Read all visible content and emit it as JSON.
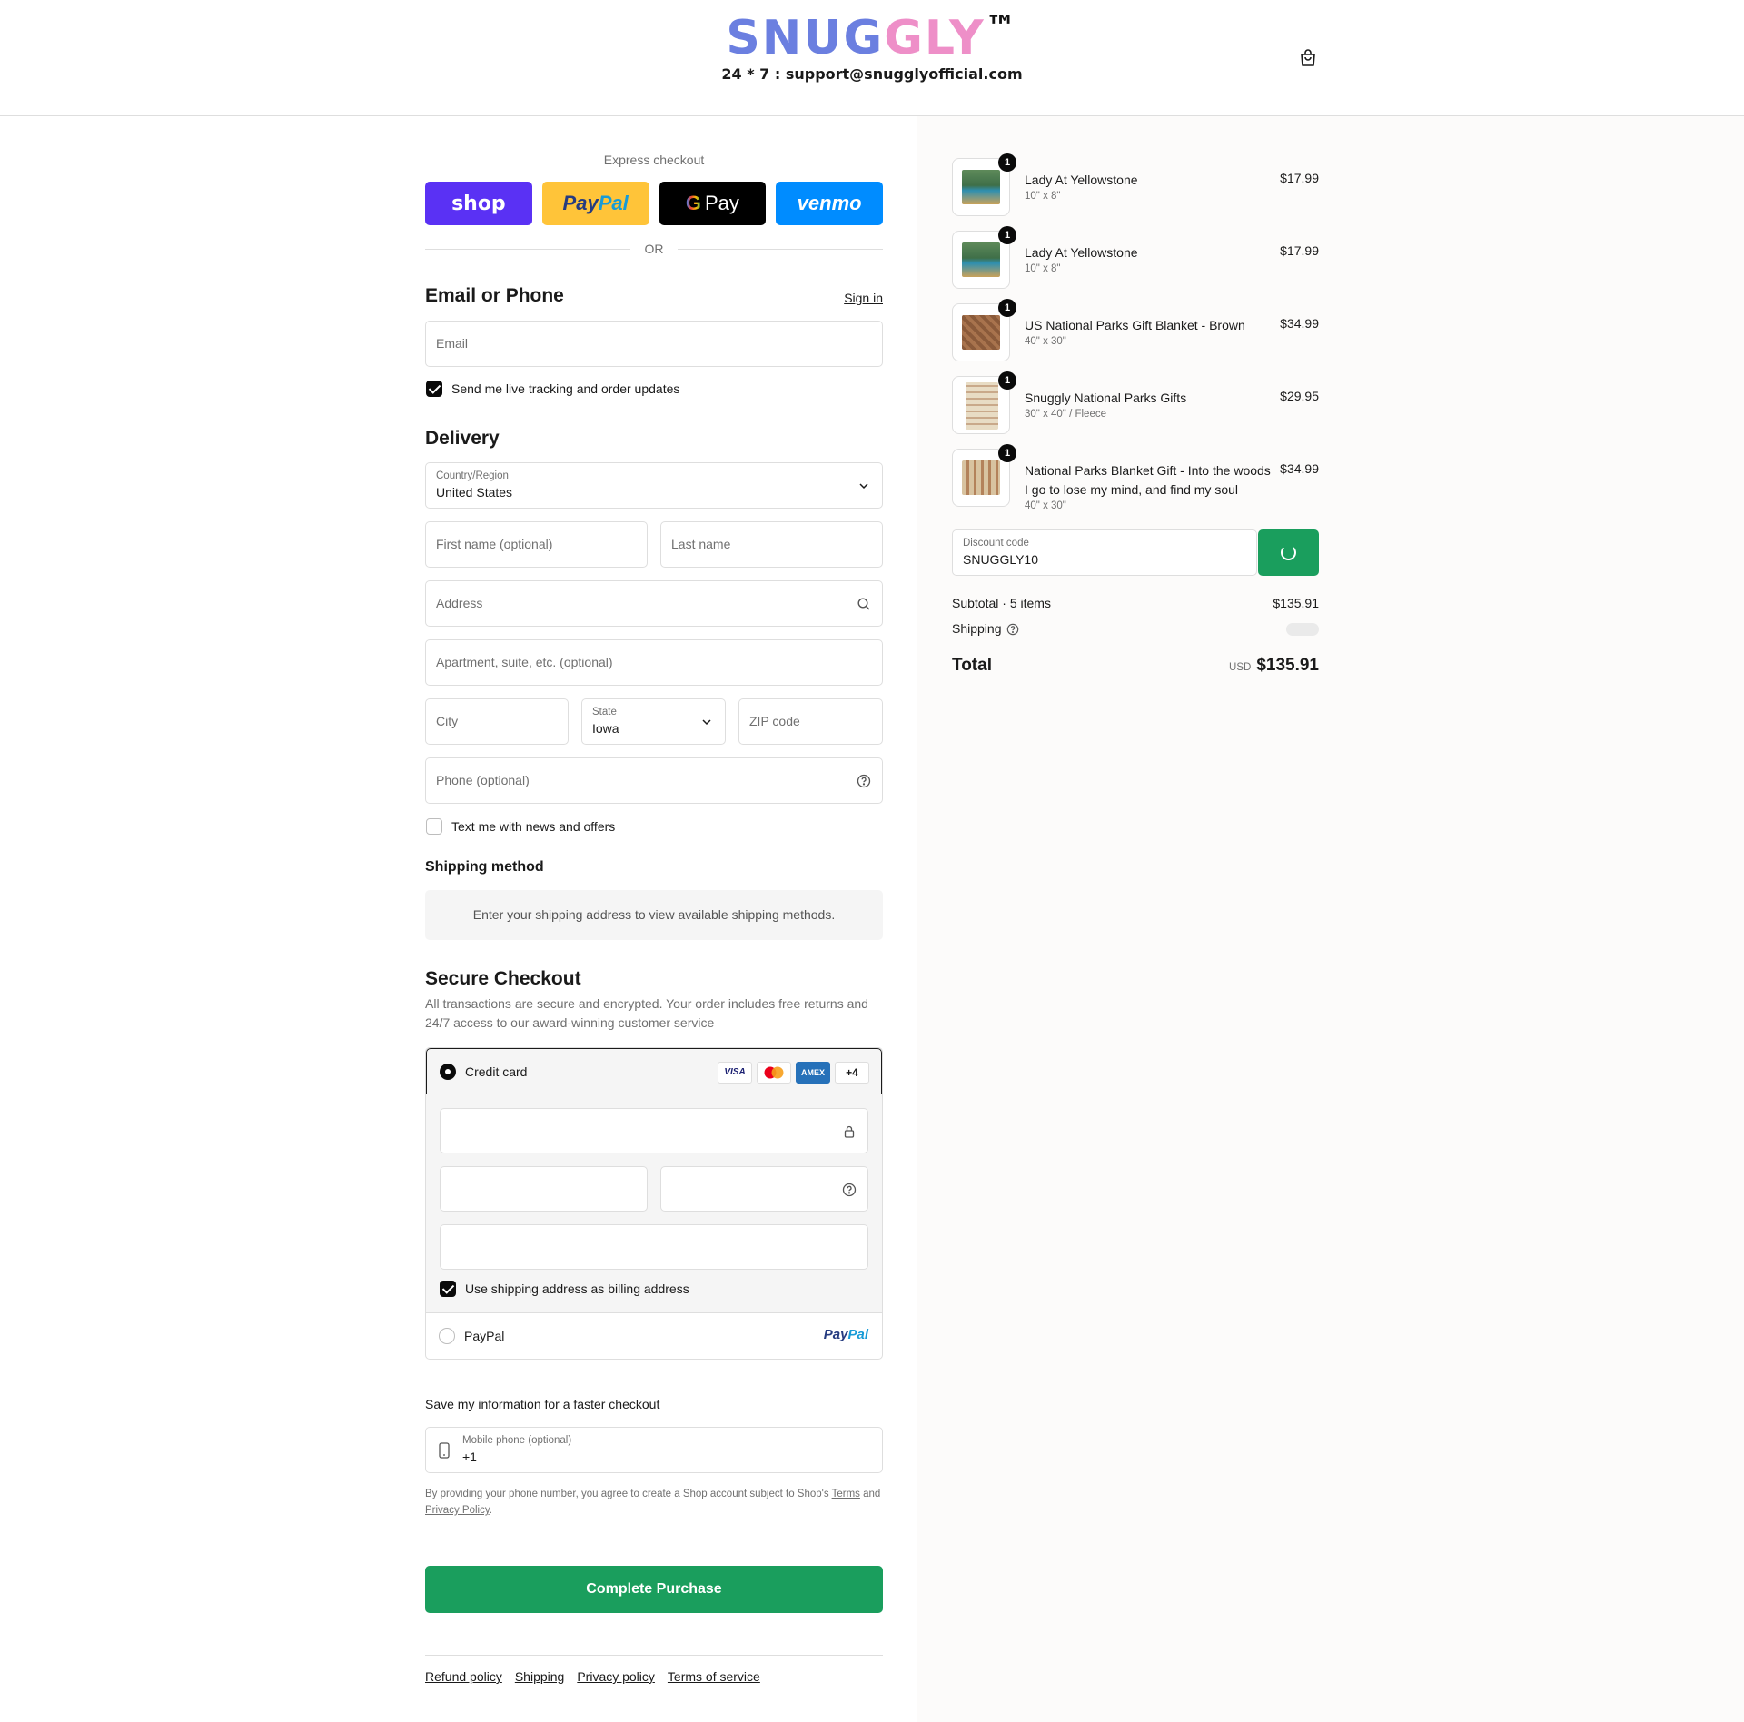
{
  "header": {
    "logo_part1": "SNUG",
    "logo_part2": "GLY",
    "logo_tm": "™",
    "support": "24 * 7 : support@snugglyofficial.com",
    "cart_icon": "shopping-bag-icon"
  },
  "express": {
    "label": "Express checkout",
    "shop": "shop",
    "paypal_1": "Pay",
    "paypal_2": "Pal",
    "gpay_g": "G",
    "gpay": "Pay",
    "venmo": "venmo",
    "or": "OR"
  },
  "contact": {
    "title": "Email or Phone",
    "signin": "Sign in",
    "email_placeholder": "Email",
    "tracking_label": "Send me live tracking and order updates",
    "tracking_checked": true
  },
  "delivery": {
    "title": "Delivery",
    "country_label": "Country/Region",
    "country_value": "United States",
    "first_name_placeholder": "First name (optional)",
    "last_name_placeholder": "Last name",
    "address_placeholder": "Address",
    "apartment_placeholder": "Apartment, suite, etc. (optional)",
    "city_placeholder": "City",
    "state_label": "State",
    "state_value": "Iowa",
    "zip_placeholder": "ZIP code",
    "phone_placeholder": "Phone (optional)",
    "sms_label": "Text me with news and offers",
    "sms_checked": false
  },
  "shipping_method": {
    "title": "Shipping method",
    "note": "Enter your shipping address to view available shipping methods."
  },
  "payment": {
    "title": "Secure Checkout",
    "description": "All transactions are secure and encrypted. Your order includes free returns and 24/7 access to our award-winning customer service",
    "credit_card_label": "Credit card",
    "card_visa": "VISA",
    "card_amex": "AMEX",
    "card_more": "+4",
    "billing_label": "Use shipping address as billing address",
    "billing_checked": true,
    "paypal_label": "PayPal",
    "paypal_logo_1": "Pay",
    "paypal_logo_2": "Pal"
  },
  "save_info": {
    "title": "Save my information for a faster checkout",
    "mobile_label": "Mobile phone (optional)",
    "mobile_value": "+1",
    "terms_1": "By providing your phone number, you agree to create a Shop account subject to Shop's ",
    "terms_link": "Terms",
    "terms_2": " and ",
    "privacy_link": "Privacy Policy",
    "terms_3": "."
  },
  "complete_button": "Complete Purchase",
  "footer_links": [
    "Refund policy",
    "Shipping",
    "Privacy policy",
    "Terms of service"
  ],
  "order_items": [
    {
      "qty": "1",
      "name": "Lady At Yellowstone",
      "variant": "10\" x 8\"",
      "price": "$17.99"
    },
    {
      "qty": "1",
      "name": "Lady At Yellowstone",
      "variant": "10\" x 8\"",
      "price": "$17.99"
    },
    {
      "qty": "1",
      "name": "US National Parks Gift Blanket - Brown",
      "variant": "40\" x 30\"",
      "price": "$34.99"
    },
    {
      "qty": "1",
      "name": "Snuggly National Parks Gifts",
      "variant": "30\" x 40\" / Fleece",
      "price": "$29.95"
    },
    {
      "qty": "1",
      "name": "National Parks Blanket Gift - Into the woods I go to lose my mind, and find my soul",
      "variant": "40\" x 30\"",
      "price": "$34.99"
    }
  ],
  "summary": {
    "discount_label": "Discount code",
    "discount_value": "SNUGGLY10",
    "subtotal_label": "Subtotal · 5 items",
    "subtotal_value": "$135.91",
    "shipping_label": "Shipping",
    "total_label": "Total",
    "currency": "USD",
    "total_value": "$135.91"
  },
  "colors": {
    "accent_green": "#1a9e5d",
    "logo_blue": "#6b7fe0",
    "logo_pink": "#ee8fc8",
    "shop_purple": "#5a31f4",
    "paypal_yellow": "#ffc439",
    "venmo_blue": "#008cff"
  }
}
